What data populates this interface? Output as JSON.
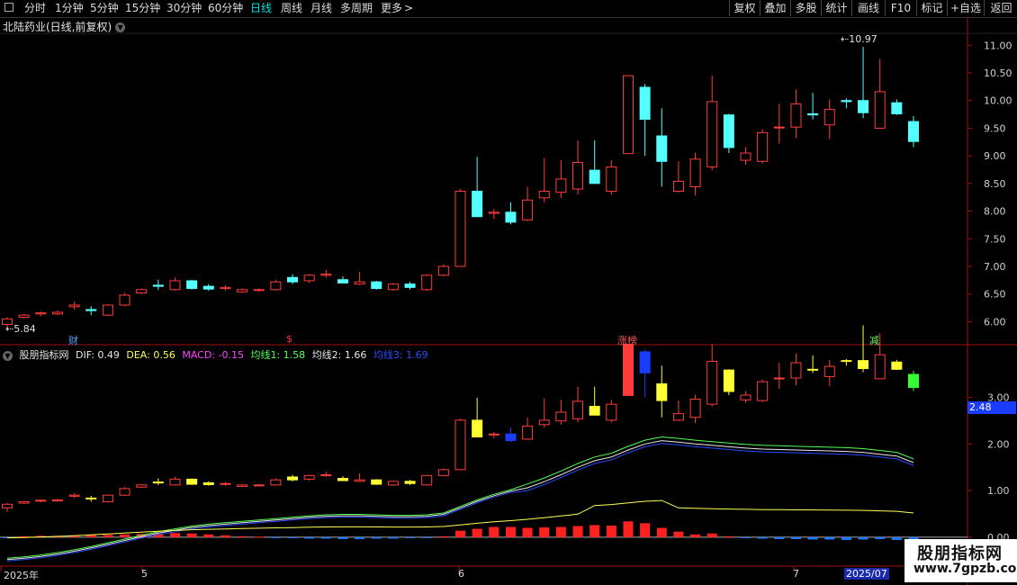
{
  "toolbar": {
    "left_icon": "square-icon",
    "periods": [
      "分时",
      "1分钟",
      "5分钟",
      "15分钟",
      "30分钟",
      "60分钟",
      "日线",
      "周线",
      "月线",
      "多周期",
      "更多"
    ],
    "active_period": "日线",
    "more_arrow": ">",
    "right_items": [
      "复权",
      "叠加",
      "多股",
      "统计",
      "画线",
      "F10",
      "标记",
      "+自选",
      "返回"
    ]
  },
  "main_panel": {
    "title": "北陆药业(日线,前复权)",
    "max_price_label": "10.97",
    "min_price_label": "5.84",
    "y_ticks": [
      "11.00",
      "10.50",
      "10.00",
      "9.50",
      "9.00",
      "8.50",
      "8.00",
      "7.50",
      "7.00",
      "6.50",
      "6.00"
    ],
    "markers": [
      {
        "text": "财",
        "color": "#4fa3ff"
      },
      {
        "text": "$",
        "color": "#ff3030"
      },
      {
        "text": "涨榜",
        "color": "#ff5555"
      },
      {
        "text": "减",
        "color": "#66ff66"
      }
    ]
  },
  "indicator_panel": {
    "name": "股朋指标网",
    "dif": "DIF: 0.49",
    "dea": "DEA: 0.56",
    "macd": "MACD: -0.15",
    "ma1": "均线1: 1.58",
    "ma2": "均线2: 1.66",
    "ma3": "均线3: 1.69",
    "y_ticks": [
      "3.00",
      "2.00",
      "1.00",
      "0.00"
    ],
    "current_value": "2.48"
  },
  "dates": {
    "labels": [
      "2025年",
      "5",
      "6",
      "7"
    ],
    "cursor_date": "2025/07"
  },
  "watermark": {
    "name": "股朋指标网",
    "url": "www.7gpzb.com"
  },
  "colors": {
    "up": "#ff3c3c",
    "down": "#54ffff",
    "ind_down": "#ffff33",
    "ind_blue": "#1a3cff"
  },
  "chart_data": {
    "type": "candlestick",
    "title": "北陆药业(日线,前复权)",
    "x_labels": [
      "2025年",
      "5",
      "6",
      "7"
    ],
    "price_ylim": [
      5.6,
      11.2
    ],
    "candles_ohlc": [
      [
        5.95,
        6.08,
        5.84,
        6.05
      ],
      [
        6.08,
        6.14,
        6.06,
        6.12
      ],
      [
        6.14,
        6.18,
        6.1,
        6.16
      ],
      [
        6.14,
        6.2,
        6.12,
        6.17
      ],
      [
        6.27,
        6.36,
        6.22,
        6.3
      ],
      [
        6.22,
        6.28,
        6.12,
        6.2
      ],
      [
        6.12,
        6.32,
        6.1,
        6.3
      ],
      [
        6.3,
        6.52,
        6.28,
        6.48
      ],
      [
        6.52,
        6.6,
        6.5,
        6.58
      ],
      [
        6.66,
        6.76,
        6.58,
        6.64
      ],
      [
        6.58,
        6.8,
        6.56,
        6.74
      ],
      [
        6.74,
        6.76,
        6.58,
        6.6
      ],
      [
        6.64,
        6.68,
        6.56,
        6.59
      ],
      [
        6.6,
        6.66,
        6.56,
        6.62
      ],
      [
        6.54,
        6.6,
        6.52,
        6.58
      ],
      [
        6.58,
        6.6,
        6.54,
        6.58
      ],
      [
        6.58,
        6.76,
        6.56,
        6.72
      ],
      [
        6.8,
        6.86,
        6.68,
        6.72
      ],
      [
        6.74,
        6.86,
        6.7,
        6.84
      ],
      [
        6.84,
        6.94,
        6.8,
        6.86
      ],
      [
        6.76,
        6.82,
        6.7,
        6.7
      ],
      [
        6.68,
        6.9,
        6.66,
        6.72
      ],
      [
        6.72,
        6.74,
        6.58,
        6.6
      ],
      [
        6.58,
        6.7,
        6.56,
        6.68
      ],
      [
        6.68,
        6.72,
        6.58,
        6.62
      ],
      [
        6.58,
        6.86,
        6.56,
        6.84
      ],
      [
        6.84,
        7.04,
        6.82,
        7.0
      ],
      [
        7.0,
        8.4,
        7.0,
        8.36
      ],
      [
        8.36,
        8.98,
        7.94,
        7.9
      ],
      [
        7.96,
        8.04,
        7.86,
        7.98
      ],
      [
        7.98,
        8.16,
        7.76,
        7.8
      ],
      [
        7.84,
        8.44,
        7.82,
        8.2
      ],
      [
        8.24,
        8.96,
        8.16,
        8.36
      ],
      [
        8.34,
        8.92,
        8.24,
        8.58
      ],
      [
        8.4,
        9.28,
        8.3,
        8.88
      ],
      [
        8.74,
        9.28,
        8.5,
        8.5
      ],
      [
        8.36,
        8.92,
        8.3,
        8.8
      ],
      [
        9.04,
        10.45,
        9.04,
        10.45
      ],
      [
        10.24,
        10.3,
        9.0,
        9.66
      ],
      [
        9.36,
        9.86,
        8.44,
        8.9
      ],
      [
        8.36,
        8.9,
        8.34,
        8.54
      ],
      [
        8.44,
        9.06,
        8.28,
        8.94
      ],
      [
        8.8,
        10.45,
        8.74,
        9.98
      ],
      [
        9.74,
        9.76,
        9.05,
        9.15
      ],
      [
        8.92,
        9.16,
        8.84,
        9.05
      ],
      [
        8.9,
        9.48,
        8.86,
        9.42
      ],
      [
        9.52,
        9.94,
        9.22,
        9.52
      ],
      [
        9.52,
        10.2,
        9.32,
        9.94
      ],
      [
        9.76,
        10.14,
        9.66,
        9.74
      ],
      [
        9.56,
        10.02,
        9.3,
        9.84
      ],
      [
        10.0,
        10.04,
        9.86,
        9.98
      ],
      [
        10.0,
        10.97,
        9.68,
        9.78
      ],
      [
        9.5,
        10.75,
        9.5,
        10.16
      ],
      [
        9.96,
        10.02,
        9.74,
        9.76
      ],
      [
        9.62,
        9.72,
        9.16,
        9.26
      ]
    ],
    "indicator_ylim": [
      -0.6,
      3.8
    ],
    "indicator_series": [
      {
        "name": "DIF",
        "value": 0.49
      },
      {
        "name": "DEA",
        "value": 0.56
      },
      {
        "name": "MACD",
        "value": -0.15
      },
      {
        "name": "均线1",
        "value": 1.58
      },
      {
        "name": "均线2",
        "value": 1.66
      },
      {
        "name": "均线3",
        "value": 1.69
      }
    ]
  }
}
